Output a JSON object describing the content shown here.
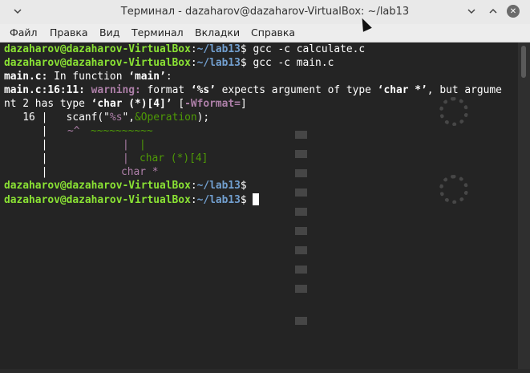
{
  "window": {
    "title": "Терминал - dazaharov@dazaharov-VirtualBox: ~/lab13",
    "left_icon": "chevron-down-icon",
    "controls": [
      "minimize-icon",
      "maximize-icon",
      "close-icon"
    ]
  },
  "menu": {
    "items": [
      "Файл",
      "Правка",
      "Вид",
      "Терминал",
      "Вкладки",
      "Справка"
    ]
  },
  "prompt": {
    "user_host": "dazaharov@dazaharov-VirtualBox",
    "path": "~/lab13",
    "symbol": "$"
  },
  "terminal": {
    "commands": [
      "gcc -c calculate.c",
      "gcc -c main.c"
    ],
    "line_main_file": "main.c:",
    "line_main_rest": " In function ",
    "line_main_func": "‘main’",
    "line_main_colon": ":",
    "warn_loc": "main.c:16:11:",
    "warn_label": "warning:",
    "warn_text1": " format ",
    "warn_fmt": "‘%s’",
    "warn_text2": " expects argument of type ",
    "warn_type1": "‘char *’",
    "warn_text3": ", but argume",
    "warn_cont1": "nt 2 has type ",
    "warn_type2": "‘char (*)[4]’",
    "warn_sp": " ",
    "warn_flag": "[-Wformat=]",
    "code_lineno": "   16 |",
    "code_pre": "   scanf(\"",
    "code_fmt": "%s",
    "code_mid": "\",",
    "code_arg": "&Operation",
    "code_end": ");",
    "marker_bar": "      |",
    "marker_1": "            ~^  ~~~~~~~~~~",
    "marker_2a": "             |  ",
    "marker_2b": "|",
    "marker_3a": "             |  ",
    "marker_3b": "char (*)[4]",
    "marker_4": "            char *"
  },
  "colors": {
    "prompt_user": "#8ae234",
    "prompt_path": "#729fcf",
    "warning": "#ad7fa8",
    "hint": "#4e9a06",
    "background": "#242424"
  }
}
